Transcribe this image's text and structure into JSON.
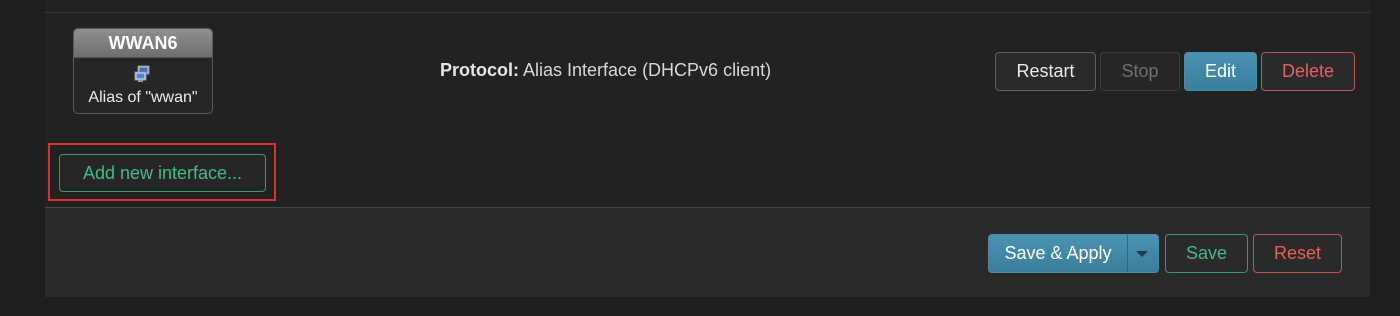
{
  "interface": {
    "name": "WWAN6",
    "description": "Alias of \"wwan\"",
    "icon": "network-alias-icon",
    "protocol_label": "Protocol:",
    "protocol_value": " Alias Interface (DHCPv6 client)"
  },
  "row_actions": {
    "restart": "Restart",
    "stop": "Stop",
    "edit": "Edit",
    "delete": "Delete"
  },
  "add_interface_label": "Add new interface...",
  "footer": {
    "save_apply": "Save & Apply",
    "save": "Save",
    "reset": "Reset"
  },
  "colors": {
    "accent_blue": "#3f87a6",
    "positive_green": "#3fbf84",
    "negative_red": "#e8625c",
    "highlight_red": "#d9342b"
  }
}
